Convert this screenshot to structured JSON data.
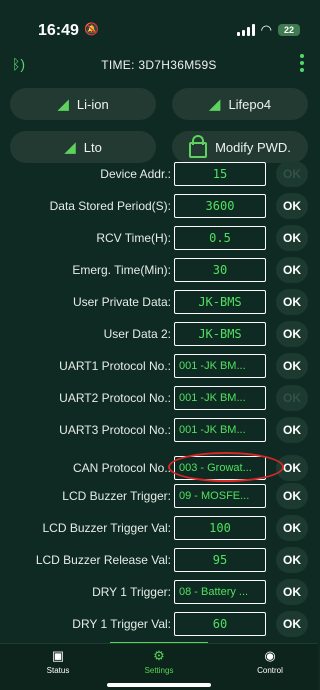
{
  "status_bar": {
    "time": "16:49",
    "battery": "22"
  },
  "header": {
    "title": "TIME: 3D7H36M59S"
  },
  "top_buttons": [
    {
      "label": "Li-ion"
    },
    {
      "label": "Lifepo4"
    },
    {
      "label": "Lto"
    },
    {
      "label": "Modify PWD."
    }
  ],
  "rows": [
    {
      "label": "Device Addr.:",
      "value": "15",
      "ok": "OK"
    },
    {
      "label": "Data Stored Period(S):",
      "value": "3600",
      "ok": "OK"
    },
    {
      "label": "RCV Time(H):",
      "value": "0.5",
      "ok": "OK"
    },
    {
      "label": "Emerg. Time(Min):",
      "value": "30",
      "ok": "OK"
    },
    {
      "label": "User Private Data:",
      "value": "JK-BMS",
      "ok": "OK"
    },
    {
      "label": "User Data 2:",
      "value": "JK-BMS",
      "ok": "OK"
    },
    {
      "label": "UART1 Protocol No.:",
      "value": "001 -JK BM...",
      "ok": "OK"
    },
    {
      "label": "UART2 Protocol No.:",
      "value": "001 -JK BM...",
      "ok": "OK"
    },
    {
      "label": "UART3 Protocol No.:",
      "value": "001 -JK BM...",
      "ok": "OK"
    },
    {
      "label": "CAN Protocol No.:",
      "value": "003 - Growat...",
      "ok": "OK"
    },
    {
      "label": "LCD Buzzer Trigger:",
      "value": "09 - MOSFE...",
      "ok": "OK"
    },
    {
      "label": "LCD Buzzer Trigger Val:",
      "value": "100",
      "ok": "OK"
    },
    {
      "label": "LCD Buzzer Release Val:",
      "value": "95",
      "ok": "OK"
    },
    {
      "label": "DRY 1 Trigger:",
      "value": "08 - Battery ...",
      "ok": "OK"
    },
    {
      "label": "DRY 1 Trigger Val:",
      "value": "60",
      "ok": "OK"
    }
  ],
  "nav": [
    {
      "label": "Status"
    },
    {
      "label": "Settings"
    },
    {
      "label": "Control"
    }
  ],
  "colors": {
    "background": "#0f2a22",
    "accent": "#56d456",
    "value_text": "#50e060",
    "highlight": "#d62828"
  }
}
